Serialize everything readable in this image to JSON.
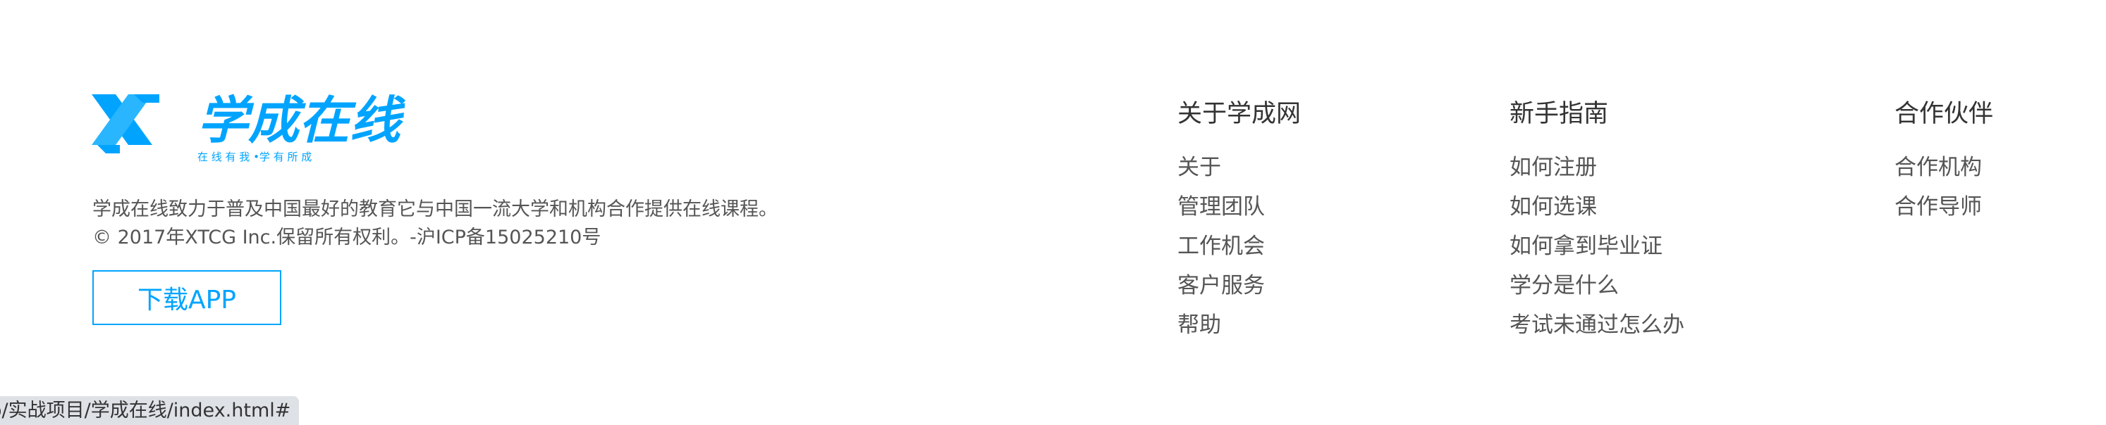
{
  "logo": {
    "brand_text": "学成在线",
    "slogan": "在 线 有 我  •学 有 所 成",
    "color": "#00a4ff"
  },
  "description": {
    "line1": "学成在线致力于普及中国最好的教育它与中国一流大学和机构合作提供在线课程。",
    "line2": "© 2017年XTCG Inc.保留所有权利。-沪ICP备15025210号"
  },
  "download_button": {
    "label": "下载APP"
  },
  "columns": [
    {
      "title": "关于学成网",
      "items": [
        "关于",
        "管理团队",
        "工作机会",
        "客户服务",
        "帮助"
      ]
    },
    {
      "title": "新手指南",
      "items": [
        "如何注册",
        "如何选课",
        "如何拿到毕业证",
        "学分是什么",
        "考试未通过怎么办"
      ]
    },
    {
      "title": "合作伙伴",
      "items": [
        "合作机构",
        "合作导师"
      ]
    }
  ],
  "status_bar": {
    "url": "o/实战项目/学成在线/index.html#"
  }
}
